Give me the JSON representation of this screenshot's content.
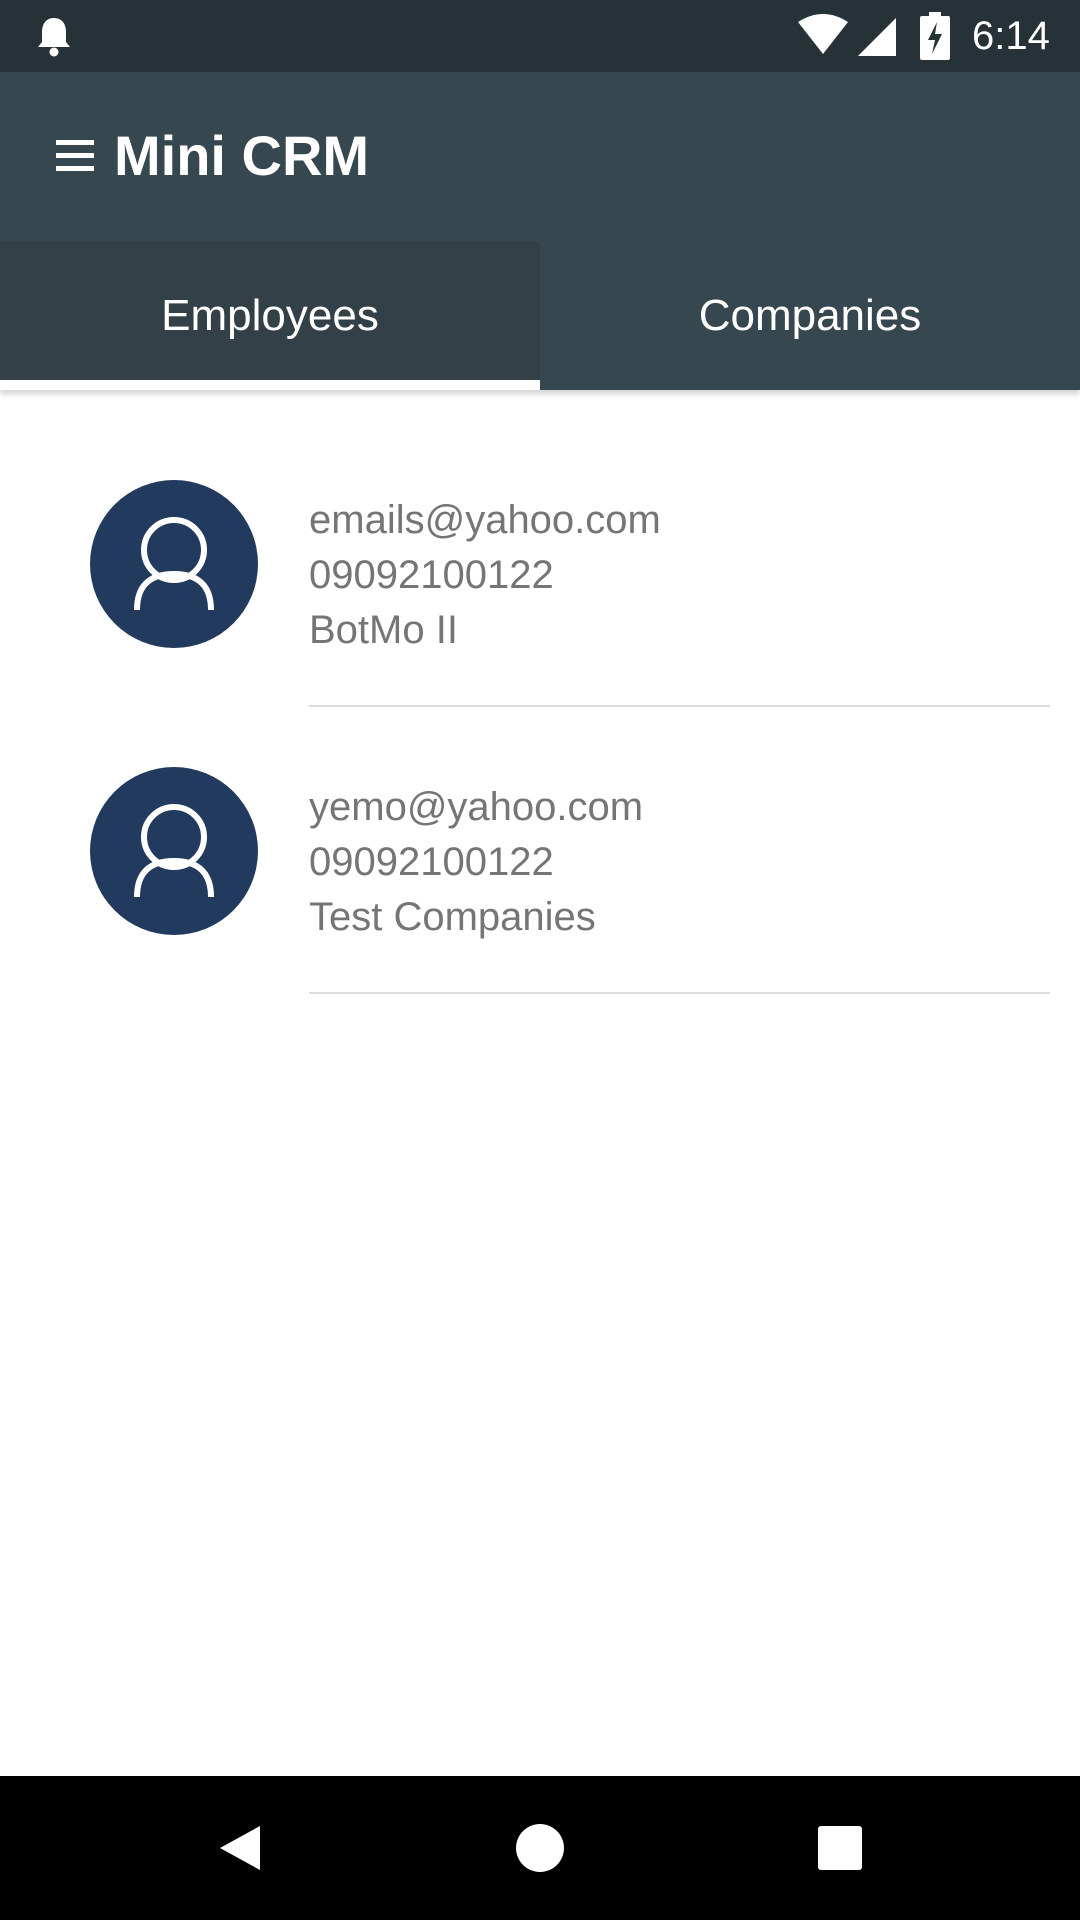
{
  "status_bar": {
    "time": "6:14",
    "icons": [
      "notification-bell-icon",
      "wifi-icon",
      "cell-signal-icon",
      "battery-charging-icon"
    ]
  },
  "app_bar": {
    "title": "Mini CRM",
    "menu_icon": "hamburger-menu-icon"
  },
  "tabs": [
    {
      "label": "Employees",
      "active": true
    },
    {
      "label": "Companies",
      "active": false
    }
  ],
  "employees": [
    {
      "email": "emails@yahoo.com",
      "phone": "09092100122",
      "company": "BotMo II",
      "icon": "person-avatar-icon"
    },
    {
      "email": "yemo@yahoo.com",
      "phone": "09092100122",
      "company": "Test Companies",
      "icon": "person-avatar-icon"
    }
  ],
  "nav_bar": {
    "icons": [
      "back-icon",
      "home-icon",
      "recents-icon"
    ]
  },
  "colors": {
    "status_bar": "#263238",
    "app_bar": "#37474f",
    "active_tab": "#344047",
    "avatar": "#223a5e",
    "text_secondary": "#757575"
  }
}
